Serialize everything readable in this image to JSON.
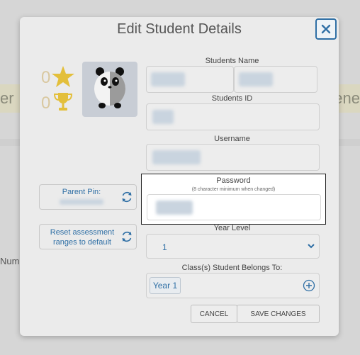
{
  "background": {
    "left_fragment": "er",
    "right_fragment": "ene",
    "side_fragment": "Nume"
  },
  "modal": {
    "title": "Edit Student Details",
    "close_icon": "close-icon",
    "stats": {
      "stars": "0",
      "trophies": "0"
    },
    "fields": {
      "students_name_label": "Students Name",
      "students_id_label": "Students ID",
      "username_label": "Username",
      "password_label": "Password",
      "password_hint": "(8 character minimum when changed)",
      "year_level_label": "Year Level",
      "year_level_value": "1",
      "classes_label": "Class(s) Student Belongs To:",
      "classes": [
        "Year 1"
      ]
    },
    "side_actions": {
      "parent_pin_label": "Parent Pin:",
      "reset_label": "Reset assessment ranges to default"
    },
    "buttons": {
      "cancel": "CANCEL",
      "save": "SAVE CHANGES"
    },
    "colors": {
      "accent": "#2f6fa5",
      "star": "#e3bf3b",
      "overlay": "#d6d6d6"
    }
  }
}
